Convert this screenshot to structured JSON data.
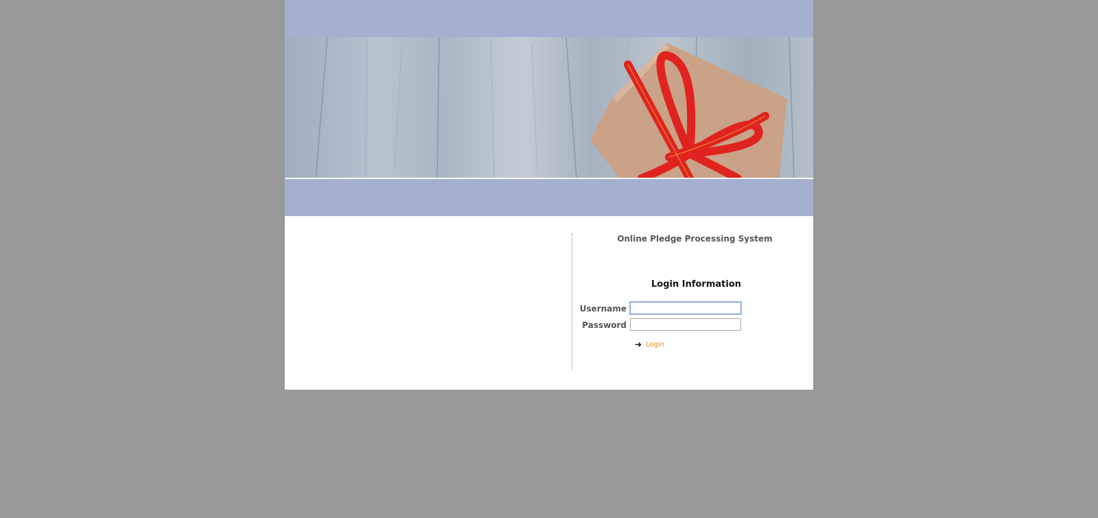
{
  "header": {
    "banner_image": "wooden-planks-gift-box-red-ribbon"
  },
  "login": {
    "system_title": "Online Pledge Processing System",
    "heading": "Login Information",
    "username_label": "Username",
    "username_value": "",
    "password_label": "Password",
    "password_value": "",
    "submit_label": "Login",
    "submit_icon": "right-arrow-icon"
  },
  "colors": {
    "page_background": "#999999",
    "band": "#a5afd0",
    "link": "#e08a1e",
    "label": "#555555"
  }
}
